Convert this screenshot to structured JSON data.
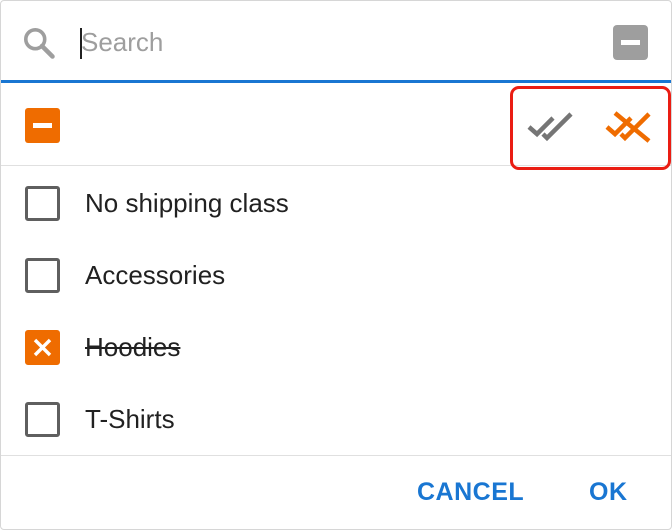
{
  "search": {
    "placeholder": "Search",
    "value": ""
  },
  "items": [
    {
      "label": "No shipping class",
      "state": "unchecked"
    },
    {
      "label": "Accessories",
      "state": "unchecked"
    },
    {
      "label": "Hoodies",
      "state": "excluded"
    },
    {
      "label": "T-Shirts",
      "state": "unchecked"
    }
  ],
  "footer": {
    "cancel_label": "CANCEL",
    "ok_label": "OK"
  },
  "icons": {
    "search": "search-icon",
    "clear": "minus-icon",
    "indeterminate": "minus-icon",
    "select_all": "double-check-icon",
    "deselect_all": "double-check-off-icon",
    "excluded": "close-icon"
  },
  "colors": {
    "accent": "#1976d2",
    "orange": "#ef6c00",
    "highlight": "#ea1d13",
    "gray_icon": "#757575"
  }
}
